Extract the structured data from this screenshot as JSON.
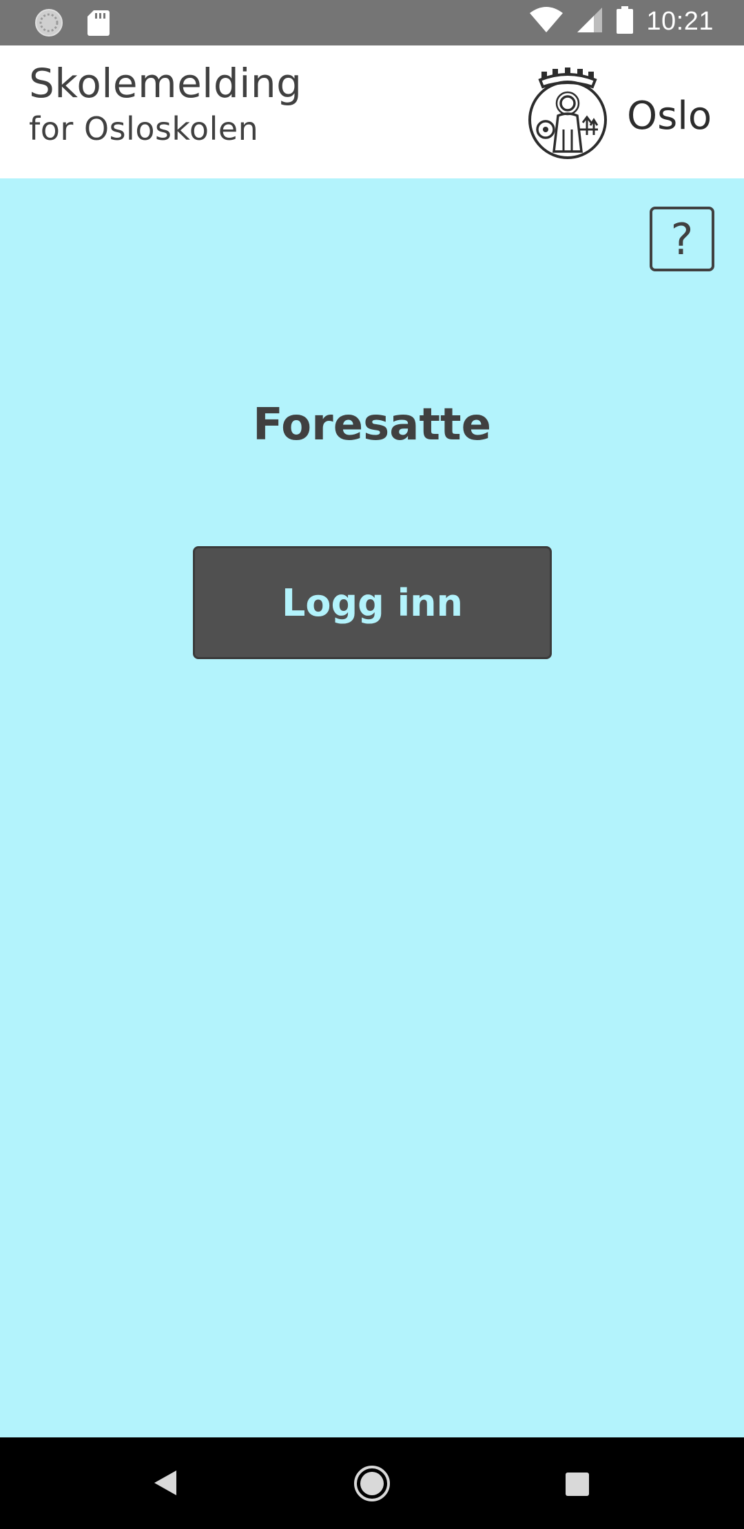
{
  "status_bar": {
    "time": "10:21",
    "icons": [
      "sync-icon",
      "sd-card-icon",
      "wifi-icon",
      "cell-signal-icon",
      "battery-icon"
    ]
  },
  "header": {
    "title": "Skolemelding",
    "subtitle": "for Osloskolen",
    "brand_text": "Oslo",
    "logo_icon": "oslo-coat-of-arms-icon"
  },
  "main": {
    "help_label": "?",
    "heading": "Foresatte",
    "login_label": "Logg inn"
  },
  "nav_bar": {
    "icons": [
      "back-icon",
      "home-icon",
      "recents-icon"
    ]
  },
  "colors": {
    "background": "#b3f3fc",
    "button": "#505050",
    "text": "#404040",
    "status_bar": "#757575"
  }
}
